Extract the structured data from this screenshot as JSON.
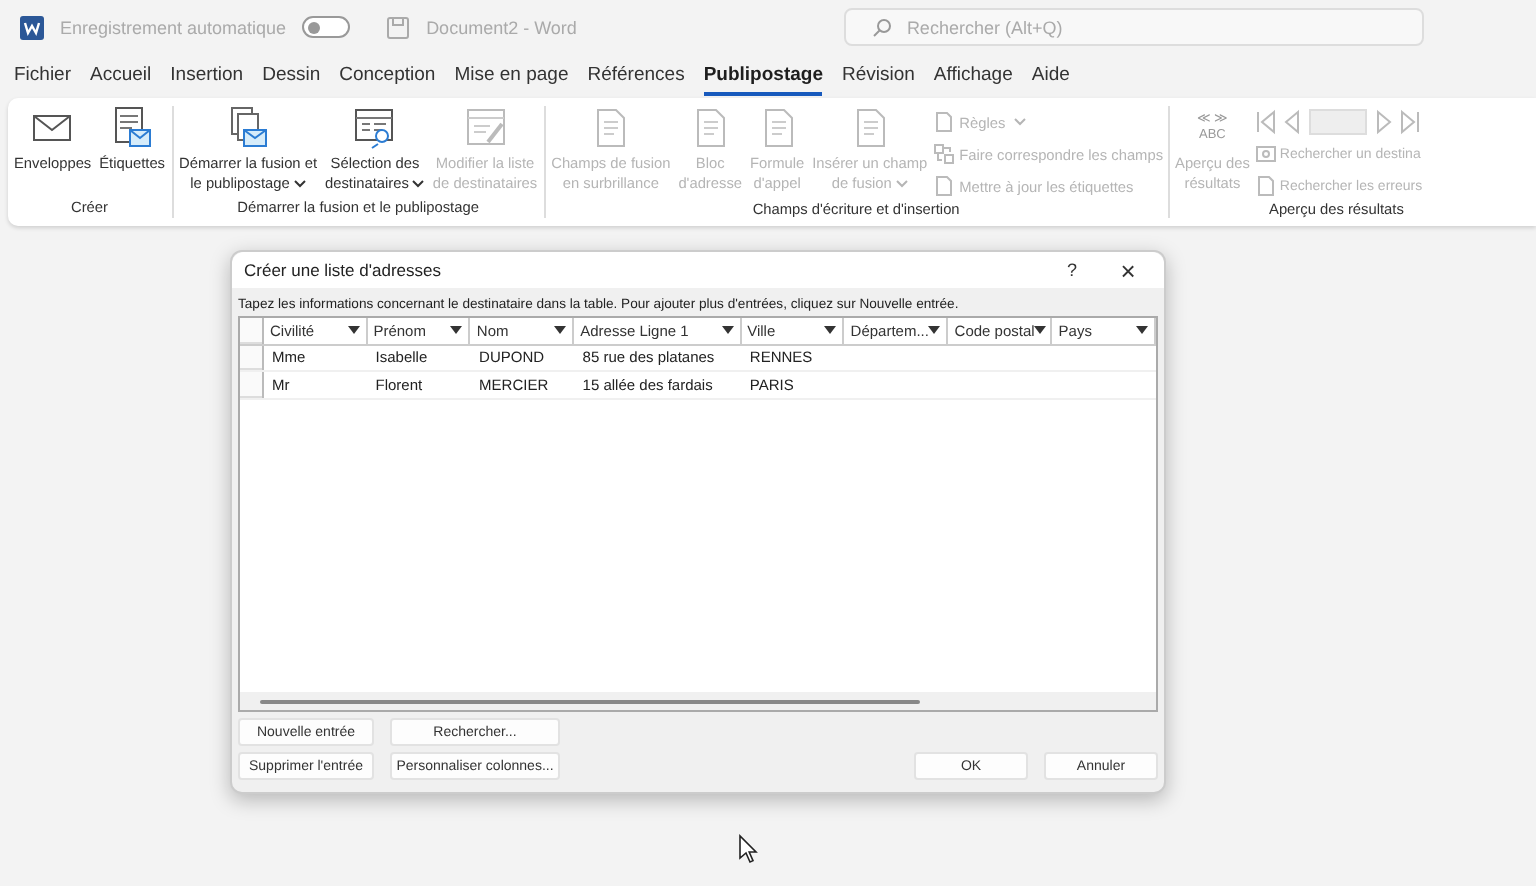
{
  "titlebar": {
    "autosave_label": "Enregistrement automatique",
    "autosave_on": false,
    "document_title": "Document2 - Word",
    "search": {
      "placeholder": "Rechercher (Alt+Q)"
    }
  },
  "tabs": [
    {
      "label": "Fichier",
      "selected": false
    },
    {
      "label": "Accueil",
      "selected": false
    },
    {
      "label": "Insertion",
      "selected": false
    },
    {
      "label": "Dessin",
      "selected": false
    },
    {
      "label": "Conception",
      "selected": false
    },
    {
      "label": "Mise en page",
      "selected": false
    },
    {
      "label": "Références",
      "selected": false
    },
    {
      "label": "Publipostage",
      "selected": true
    },
    {
      "label": "Révision",
      "selected": false
    },
    {
      "label": "Affichage",
      "selected": false
    },
    {
      "label": "Aide",
      "selected": false
    }
  ],
  "ribbon": [
    {
      "label": "Créer",
      "items": [
        {
          "kind": "large",
          "lines": [
            "Enveloppes"
          ],
          "dropdown": false,
          "disabled": false
        },
        {
          "kind": "large",
          "lines": [
            "Étiquettes"
          ],
          "dropdown": false,
          "disabled": false
        }
      ]
    },
    {
      "label": "Démarrer la fusion et le publipostage",
      "items": [
        {
          "kind": "large",
          "lines": [
            "Démarrer la fusion et",
            "le publipostage"
          ],
          "dropdown": true,
          "disabled": false
        },
        {
          "kind": "large",
          "lines": [
            "Sélection des",
            "destinataires"
          ],
          "dropdown": true,
          "disabled": false
        },
        {
          "kind": "large",
          "lines": [
            "Modifier la liste",
            "de destinataires"
          ],
          "dropdown": false,
          "disabled": true
        }
      ]
    },
    {
      "label": "Champs d'écriture et d'insertion",
      "items": [
        {
          "kind": "large",
          "lines": [
            "Champs de fusion",
            "en surbrillance"
          ],
          "dropdown": false,
          "disabled": true
        },
        {
          "kind": "large",
          "lines": [
            "Bloc",
            "d'adresse"
          ],
          "dropdown": false,
          "disabled": true
        },
        {
          "kind": "large",
          "lines": [
            "Formule",
            "d'appel"
          ],
          "dropdown": false,
          "disabled": true
        },
        {
          "kind": "large",
          "lines": [
            "Insérer un champ",
            "de fusion"
          ],
          "dropdown": true,
          "disabled": true
        },
        {
          "kind": "stack",
          "entries": [
            {
              "label": "Règles",
              "dropdown": true,
              "disabled": true
            },
            {
              "label": "Faire correspondre les champs",
              "dropdown": false,
              "disabled": true
            },
            {
              "label": "Mettre à jour les étiquettes",
              "dropdown": false,
              "disabled": true
            }
          ]
        }
      ]
    },
    {
      "label": "Aperçu des résultats",
      "items": [
        {
          "kind": "large",
          "icon_text": [
            "≪ ≫",
            "ABC"
          ],
          "lines": [
            "Aperçu des",
            "résultats"
          ],
          "dropdown": false,
          "disabled": true
        },
        {
          "kind": "nav",
          "entries": [
            {
              "label": "Rechercher un destina",
              "disabled": true
            },
            {
              "label": "Rechercher les erreurs",
              "disabled": true
            }
          ]
        }
      ]
    }
  ],
  "dialog": {
    "title": "Créer une liste d'adresses",
    "help": "?",
    "close": "×",
    "instructions": "Tapez les informations concernant le destinataire dans la table. Pour ajouter plus d'entrées, cliquez sur Nouvelle entrée.",
    "table": {
      "columns": [
        "Civilité",
        "Prénom",
        "Nom",
        "Adresse Ligne 1",
        "Ville",
        "Départem...",
        "Code postal",
        "Pays"
      ],
      "rows": [
        [
          "Mme",
          "Isabelle",
          "DUPOND",
          "85 rue des platanes",
          "RENNES",
          "",
          "",
          ""
        ],
        [
          "Mr",
          "Florent",
          "MERCIER",
          "15 allée des fardais",
          "PARIS",
          "",
          "",
          ""
        ]
      ]
    },
    "left_buttons": [
      [
        "Nouvelle entrée",
        "Rechercher..."
      ],
      [
        "Supprimer l'entrée",
        "Personnaliser colonnes..."
      ]
    ],
    "ok": "OK",
    "cancel": "Annuler"
  }
}
